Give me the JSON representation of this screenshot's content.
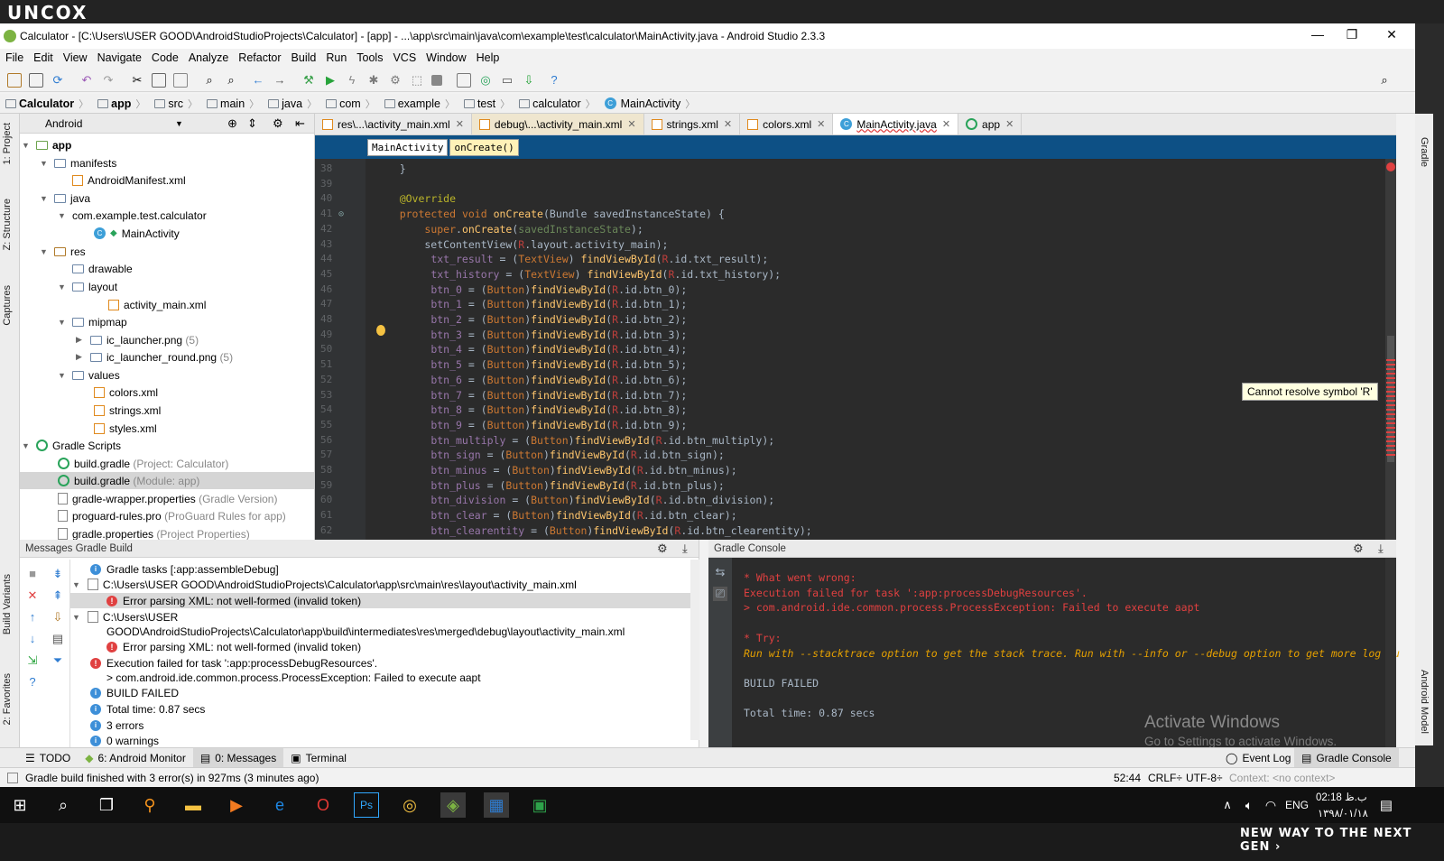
{
  "brand": {
    "name": "UNCOX",
    "tagline": "NEW WAY TO THE NEXT GEN ›"
  },
  "window": {
    "title": "Calculator - [C:\\Users\\USER GOOD\\AndroidStudioProjects\\Calculator] - [app] - ...\\app\\src\\main\\java\\com\\example\\test\\calculator\\MainActivity.java - Android Studio 2.3.3",
    "minimize": "—",
    "maximize": "❐",
    "close": "✕"
  },
  "menu": [
    "File",
    "Edit",
    "View",
    "Navigate",
    "Code",
    "Analyze",
    "Refactor",
    "Build",
    "Run",
    "Tools",
    "VCS",
    "Window",
    "Help"
  ],
  "breadcrumbs": [
    "Calculator",
    "app",
    "src",
    "main",
    "java",
    "com",
    "example",
    "test",
    "calculator",
    "MainActivity"
  ],
  "side_tabs": {
    "project": "1: Project",
    "structure": "Z: Structure",
    "captures": "Captures",
    "build_variants": "Build Variants",
    "favorites": "2: Favorites",
    "gradle": "Gradle",
    "android_model": "Android Model"
  },
  "project_panel": {
    "view": "Android",
    "tree": [
      {
        "label": "app",
        "bold": true
      },
      {
        "label": "manifests"
      },
      {
        "label": "AndroidManifest.xml"
      },
      {
        "label": "java"
      },
      {
        "label": "com.example.test.calculator"
      },
      {
        "label": "MainActivity"
      },
      {
        "label": "res"
      },
      {
        "label": "drawable"
      },
      {
        "label": "layout"
      },
      {
        "label": "activity_main.xml"
      },
      {
        "label": "mipmap"
      },
      {
        "label": "ic_launcher.png",
        "extra": "(5)"
      },
      {
        "label": "ic_launcher_round.png",
        "extra": "(5)"
      },
      {
        "label": "values"
      },
      {
        "label": "colors.xml"
      },
      {
        "label": "strings.xml"
      },
      {
        "label": "styles.xml"
      },
      {
        "label": "Gradle Scripts"
      },
      {
        "label": "build.gradle",
        "extra": "(Project: Calculator)"
      },
      {
        "label": "build.gradle",
        "extra": "(Module: app)"
      },
      {
        "label": "gradle-wrapper.properties",
        "extra": "(Gradle Version)"
      },
      {
        "label": "proguard-rules.pro",
        "extra": "(ProGuard Rules for app)"
      },
      {
        "label": "gradle.properties",
        "extra": "(Project Properties)"
      }
    ]
  },
  "editor_tabs": [
    {
      "label": "res\\...\\activity_main.xml"
    },
    {
      "label": "debug\\...\\activity_main.xml"
    },
    {
      "label": "strings.xml"
    },
    {
      "label": "colors.xml"
    },
    {
      "label": "MainActivity.java",
      "active": true
    },
    {
      "label": "app"
    }
  ],
  "code_breadcrumb": [
    "MainActivity",
    "onCreate()"
  ],
  "code_lines": [
    {
      "n": "38",
      "t": "    }"
    },
    {
      "n": "39",
      "t": ""
    },
    {
      "n": "40",
      "t": "    @Override"
    },
    {
      "n": "41",
      "t": "    protected void onCreate(Bundle savedInstanceState) {"
    },
    {
      "n": "42",
      "t": "        super.onCreate(savedInstanceState);"
    },
    {
      "n": "43",
      "t": "        setContentView(R.layout.activity_main);"
    },
    {
      "n": "44",
      "t": "         txt_result = (TextView) findViewById(R.id.txt_result);"
    },
    {
      "n": "45",
      "t": "         txt_history = (TextView) findViewById(R.id.txt_history);"
    },
    {
      "n": "46",
      "t": "         btn_0 = (Button)findViewById(R.id.btn_0);"
    },
    {
      "n": "47",
      "t": "         btn_1 = (Button)findViewById(R.id.btn_1);"
    },
    {
      "n": "48",
      "t": "         btn_2 = (Button)findViewById(R.id.btn_2);"
    },
    {
      "n": "49",
      "t": "         btn_3 = (Button)findViewById(R.id.btn_3);"
    },
    {
      "n": "50",
      "t": "         btn_4 = (Button)findViewById(R.id.btn_4);"
    },
    {
      "n": "51",
      "t": "         btn_5 = (Button)findViewById(R.id.btn_5);"
    },
    {
      "n": "52",
      "t": "         btn_6 = (Button)findViewById(R.id.btn_6);"
    },
    {
      "n": "53",
      "t": "         btn_7 = (Button)findViewById(R.id.btn_7);"
    },
    {
      "n": "54",
      "t": "         btn_8 = (Button)findViewById(R.id.btn_8);"
    },
    {
      "n": "55",
      "t": "         btn_9 = (Button)findViewById(R.id.btn_9);"
    },
    {
      "n": "56",
      "t": "         btn_multiply = (Button)findViewById(R.id.btn_multiply);"
    },
    {
      "n": "57",
      "t": "         btn_sign = (Button)findViewById(R.id.btn_sign);"
    },
    {
      "n": "58",
      "t": "         btn_minus = (Button)findViewById(R.id.btn_minus);"
    },
    {
      "n": "59",
      "t": "         btn_plus = (Button)findViewById(R.id.btn_plus);"
    },
    {
      "n": "60",
      "t": "         btn_division = (Button)findViewById(R.id.btn_division);"
    },
    {
      "n": "61",
      "t": "         btn_clear = (Button)findViewById(R.id.btn_clear);"
    },
    {
      "n": "62",
      "t": "         btn_clearentity = (Button)findViewById(R.id.btn_clearentity);"
    }
  ],
  "tooltip": "Cannot resolve symbol 'R'",
  "messages_panel": {
    "title": "Messages Gradle Build",
    "rows": [
      {
        "icon": "info",
        "text": "Gradle tasks [:app:assembleDebug]"
      },
      {
        "icon": "file",
        "text": "C:\\Users\\USER GOOD\\AndroidStudioProjects\\Calculator\\app\\src\\main\\res\\layout\\activity_main.xml"
      },
      {
        "icon": "error",
        "text": "Error parsing XML: not well-formed (invalid token)"
      },
      {
        "icon": "file",
        "text": "C:\\Users\\USER"
      },
      {
        "icon": "none",
        "text": "GOOD\\AndroidStudioProjects\\Calculator\\app\\build\\intermediates\\res\\merged\\debug\\layout\\activity_main.xml"
      },
      {
        "icon": "error",
        "text": "Error parsing XML: not well-formed (invalid token)"
      },
      {
        "icon": "error",
        "text": "Execution failed for task ':app:processDebugResources'."
      },
      {
        "icon": "none",
        "text": "> com.android.ide.common.process.ProcessException: Failed to execute aapt"
      },
      {
        "icon": "info",
        "text": "BUILD FAILED"
      },
      {
        "icon": "info",
        "text": "Total time: 0.87 secs"
      },
      {
        "icon": "info",
        "text": "3 errors"
      },
      {
        "icon": "info",
        "text": "0 warnings"
      }
    ]
  },
  "console_panel": {
    "title": "Gradle Console",
    "lines": [
      {
        "cls": "ce",
        "text": "* What went wrong:"
      },
      {
        "cls": "ce",
        "text": "Execution failed for task ':app:processDebugResources'."
      },
      {
        "cls": "ce",
        "text": "> com.android.ide.common.process.ProcessException: Failed to execute aapt"
      },
      {
        "cls": "",
        "text": ""
      },
      {
        "cls": "ce",
        "text": "* Try:"
      },
      {
        "cls": "ci",
        "text": "Run with --stacktrace option to get the stack trace. Run with --info or --debug option to get more log ou"
      },
      {
        "cls": "",
        "text": ""
      },
      {
        "cls": "",
        "text": "BUILD FAILED"
      },
      {
        "cls": "",
        "text": ""
      },
      {
        "cls": "",
        "text": "Total time: 0.87 secs"
      }
    ]
  },
  "activate": {
    "line1": "Activate Windows",
    "line2": "Go to Settings to activate Windows."
  },
  "bottom_tabs": {
    "todo": "TODO",
    "monitor": "6: Android Monitor",
    "messages": "0: Messages",
    "terminal": "Terminal",
    "event_log": "Event Log",
    "gradle_console": "Gradle Console"
  },
  "status": {
    "message": "Gradle build finished with 3 error(s) in 927ms (3 minutes ago)",
    "position": "52:44",
    "line_sep": "CRLF÷",
    "encoding": "UTF-8÷",
    "context": "Context: <no context>"
  },
  "taskbar": {
    "time": "02:18 ب.ظ",
    "date": "۱۳۹۸/۰۱/۱۸",
    "lang": "ENG"
  },
  "colors": {
    "editor_bg": "#2b2b2b",
    "keyword": "#cc7832",
    "error": "#e04040",
    "breadcrumb_bg": "#0d5085"
  }
}
